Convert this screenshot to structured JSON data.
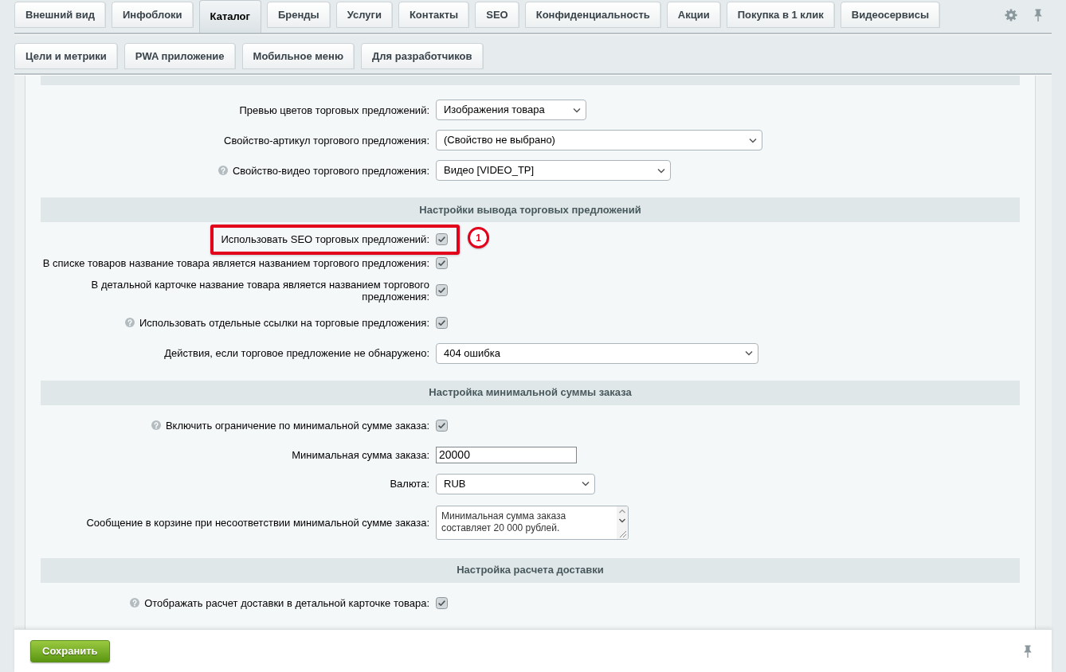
{
  "tabs_row_1": [
    {
      "label": "Внешний вид",
      "selected": false
    },
    {
      "label": "Инфоблоки",
      "selected": false
    },
    {
      "label": "Каталог",
      "selected": true
    },
    {
      "label": "Бренды",
      "selected": false
    },
    {
      "label": "Услуги",
      "selected": false
    },
    {
      "label": "Контакты",
      "selected": false
    },
    {
      "label": "SEO",
      "selected": false
    },
    {
      "label": "Конфиденциальность",
      "selected": false
    },
    {
      "label": "Акции",
      "selected": false
    },
    {
      "label": "Покупка в 1 клик",
      "selected": false
    },
    {
      "label": "Видеосервисы",
      "selected": false
    }
  ],
  "tabs_row_2": [
    {
      "label": "Цели и метрики",
      "selected": false
    },
    {
      "label": "PWA приложение",
      "selected": false
    },
    {
      "label": "Мобильное меню",
      "selected": false
    },
    {
      "label": "Для разработчиков",
      "selected": false
    }
  ],
  "sections": [
    {
      "rows": [
        {
          "kind": "select",
          "label": "Превью цветов торговых предложений:",
          "help": false,
          "value": "Изображения товара"
        },
        {
          "kind": "select",
          "label": "Свойство-артикул торгового предложения:",
          "help": false,
          "value": "(Свойство не выбрано)"
        },
        {
          "kind": "select",
          "label": "Свойство-видео торгового предложения:",
          "help": true,
          "value": "Видео [VIDEO_TP]"
        }
      ]
    },
    {
      "title": "Настройки вывода торговых предложений",
      "rows": [
        {
          "kind": "checkbox",
          "label": "Использовать SEO торговых предложений:",
          "help": false,
          "checked": true,
          "highlighted": true,
          "marker": "1"
        },
        {
          "kind": "checkbox",
          "label": "В списке товаров название товара является названием торгового предложения:",
          "help": false,
          "checked": true,
          "highlighted": false
        },
        {
          "kind": "checkbox",
          "label": "В детальной карточке название товара является названием торгового предложения:",
          "help": false,
          "checked": true,
          "highlighted": false
        },
        {
          "kind": "checkbox",
          "label": "Использовать отдельные ссылки на торговые предложения:",
          "help": true,
          "checked": true,
          "highlighted": false
        },
        {
          "kind": "select",
          "label": "Действия, если торговое предложение не обнаружено:",
          "help": false,
          "value": "404 ошибка"
        }
      ]
    },
    {
      "title": "Настройка минимальной суммы заказа",
      "rows": [
        {
          "kind": "checkbox",
          "label": "Включить ограничение по минимальной сумме заказа:",
          "help": true,
          "checked": true,
          "highlighted": false
        },
        {
          "kind": "input",
          "label": "Минимальная сумма заказа:",
          "help": false,
          "value": "20000"
        },
        {
          "kind": "select",
          "label": "Валюта:",
          "help": false,
          "value": "RUB"
        },
        {
          "kind": "textarea",
          "label": "Сообщение в корзине при несоответствии минимальной сумме заказа:",
          "help": false,
          "value": "Минимальная сумма заказа составляет 20 000 рублей."
        }
      ]
    },
    {
      "title": "Настройка расчета доставки",
      "rows": [
        {
          "kind": "checkbox",
          "label": "Отображать расчет доставки в детальной карточке товара:",
          "help": true,
          "checked": true,
          "highlighted": false
        }
      ]
    }
  ],
  "footer": {
    "save_button": "Сохранить"
  }
}
